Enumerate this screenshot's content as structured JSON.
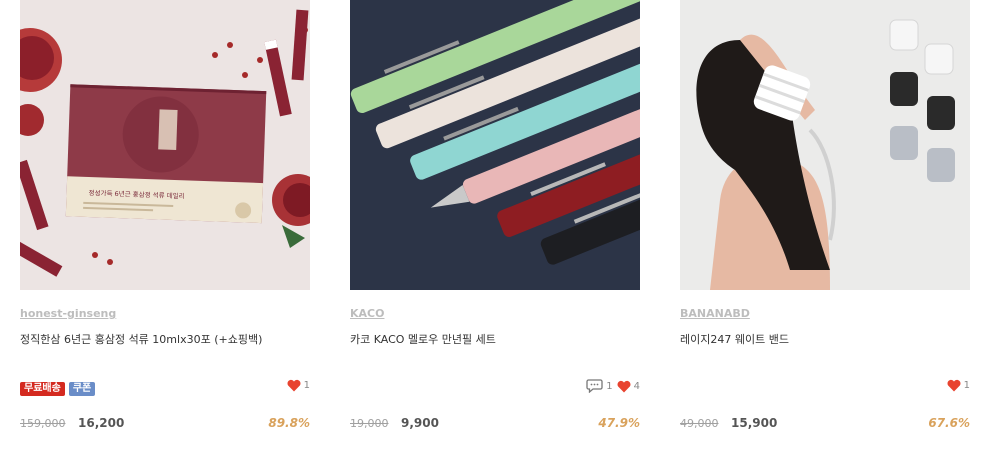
{
  "products": [
    {
      "brand": "honest-ginseng",
      "title": "정직한삼 6년근 홍삼정 석류 10mlx30포 (+쇼핑백)",
      "badges": [
        "무료배송",
        "쿠폰"
      ],
      "comments": "",
      "likes": "1",
      "original_price": "159,000",
      "price": "16,200",
      "discount": "89.8%",
      "box_text": "정성가득 6년근 홍삼정 석류 데일리"
    },
    {
      "brand": "KACO",
      "title": "카코 KACO 멜로우 만년필 세트",
      "badges": [],
      "comments": "1",
      "likes": "4",
      "original_price": "19,000",
      "price": "9,900",
      "discount": "47.9%"
    },
    {
      "brand": "BANANABD",
      "title": "레이지247 웨이트 밴드",
      "badges": [],
      "comments": "",
      "likes": "1",
      "original_price": "49,000",
      "price": "15,900",
      "discount": "67.6%"
    }
  ],
  "colors": {
    "heart": "#e8432f",
    "discount": "#d9a25c",
    "free_badge": "#d42a20",
    "coupon_badge": "#6a8dc8"
  },
  "icons": {
    "like": "heart-icon",
    "comment": "comment-icon"
  }
}
